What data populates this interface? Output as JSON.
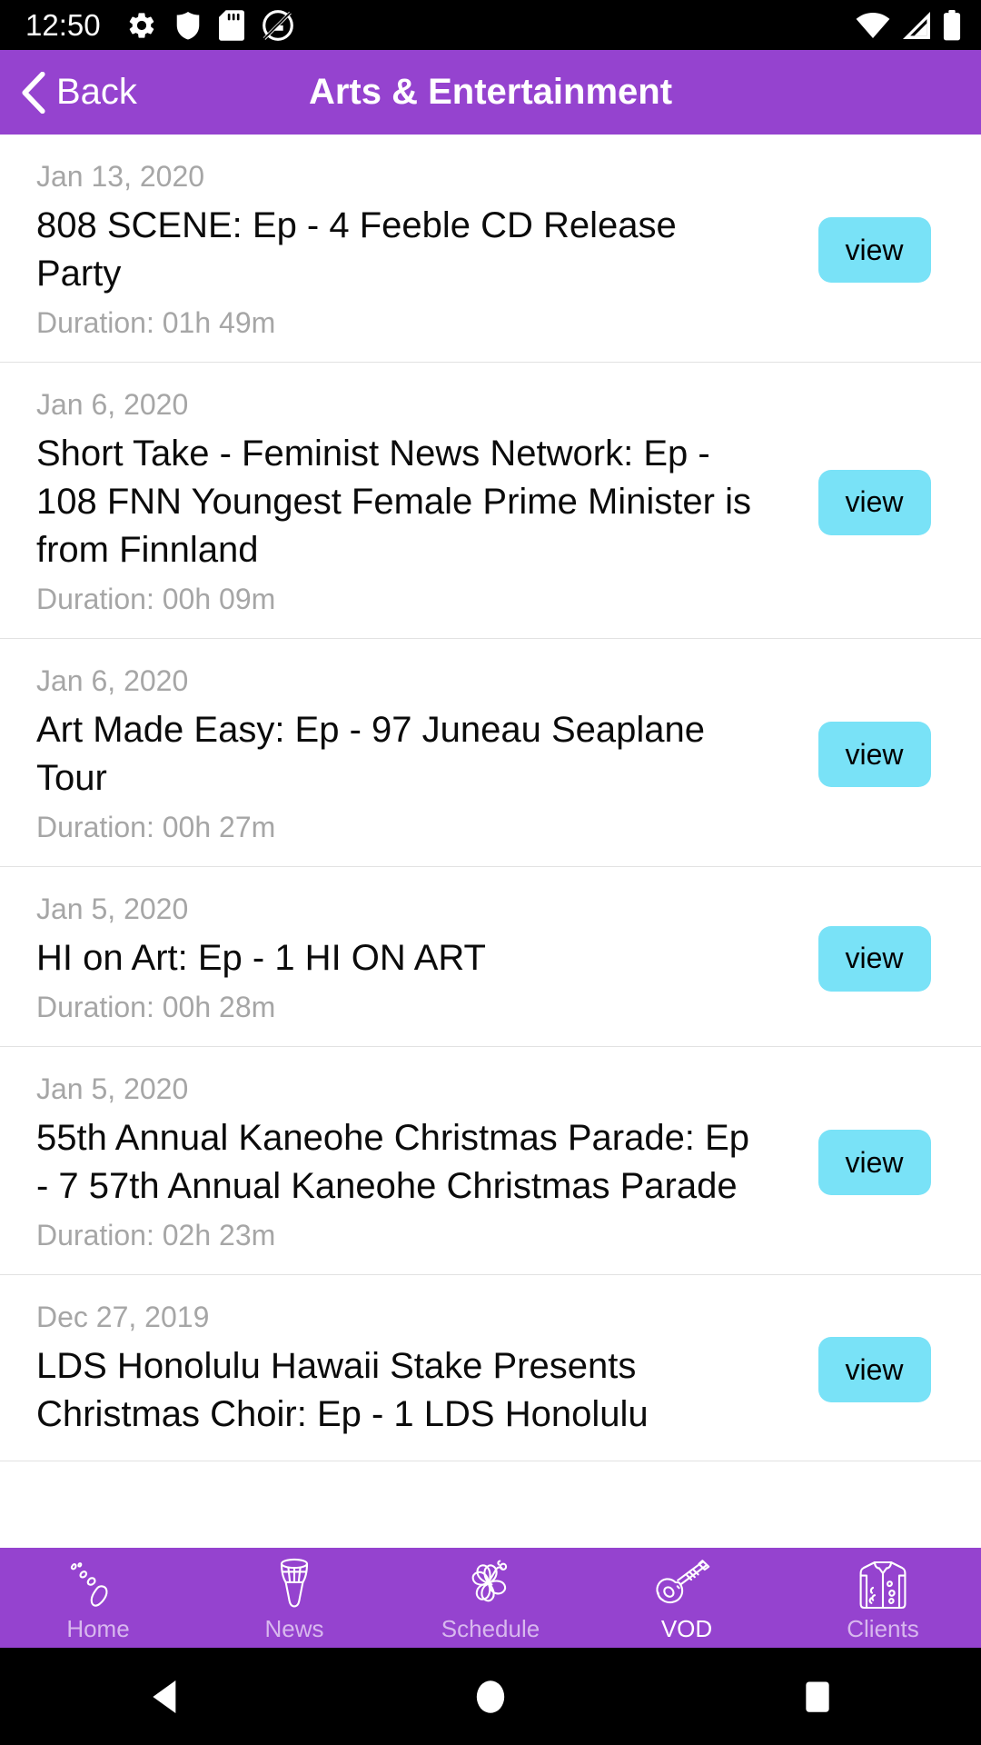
{
  "statusbar": {
    "time": "12:50",
    "left_icons": [
      "gear-icon",
      "shield-icon",
      "sdcard-icon",
      "do-not-disturb-icon"
    ],
    "right_icons": [
      "wifi-icon",
      "cellular-signal-icon",
      "battery-icon"
    ]
  },
  "header": {
    "back_label": "Back",
    "title": "Arts & Entertainment",
    "background_color": "#9543cf"
  },
  "list": {
    "view_label": "view",
    "view_button_color": "#79e2f7",
    "items": [
      {
        "date": "Jan 13, 2020",
        "title": "808 SCENE: Ep - 4 Feeble CD Release Party",
        "duration": "Duration: 01h 49m"
      },
      {
        "date": "Jan 6, 2020",
        "title": "Short Take - Feminist News Network: Ep - 108 FNN Youngest Female Prime Minister is from Finnland",
        "duration": "Duration: 00h 09m"
      },
      {
        "date": "Jan 6, 2020",
        "title": "Art Made Easy: Ep - 97 Juneau Seaplane Tour",
        "duration": "Duration: 00h 27m"
      },
      {
        "date": "Jan 5, 2020",
        "title": "HI on Art: Ep - 1 HI ON ART",
        "duration": "Duration: 00h 28m"
      },
      {
        "date": "Jan 5, 2020",
        "title": "55th Annual Kaneohe Christmas Parade: Ep - 7 57th Annual Kaneohe Christmas Parade",
        "duration": "Duration: 02h 23m"
      },
      {
        "date": "Dec 27, 2019",
        "title": "LDS Honolulu Hawaii Stake Presents Christmas Choir: Ep - 1 LDS Honolulu",
        "duration": ""
      }
    ]
  },
  "tabbar": {
    "background_color": "#9543cf",
    "active_index": 3,
    "tabs": [
      {
        "label": "Home",
        "icon": "hawaiian-islands-icon"
      },
      {
        "label": "News",
        "icon": "ipu-drum-icon"
      },
      {
        "label": "Schedule",
        "icon": "hibiscus-flower-icon"
      },
      {
        "label": "VOD",
        "icon": "ukulele-icon"
      },
      {
        "label": "Clients",
        "icon": "aloha-shirt-icon"
      }
    ]
  },
  "navbar": {
    "buttons": [
      {
        "name": "back-triangle-icon"
      },
      {
        "name": "home-circle-icon"
      },
      {
        "name": "recents-square-icon"
      }
    ]
  }
}
